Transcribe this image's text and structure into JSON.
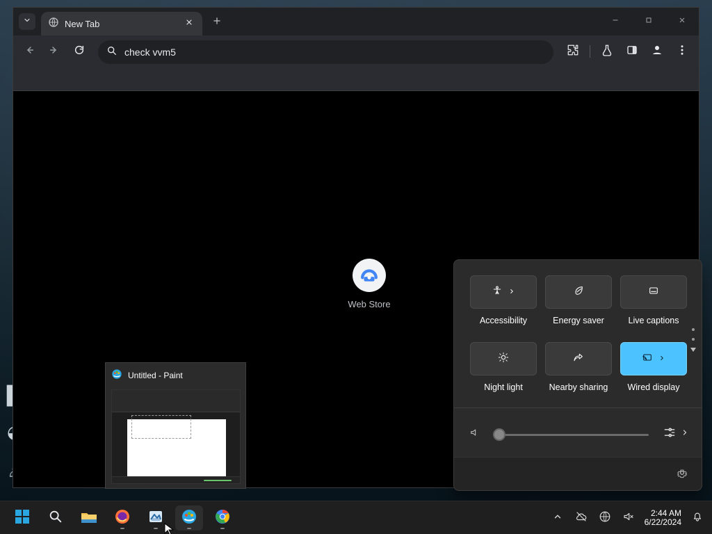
{
  "browser": {
    "tab_title": "New Tab",
    "omnibox_text": "check vvm5"
  },
  "new_tab": {
    "shortcut_label": "Web Store"
  },
  "taskbar_preview": {
    "window_title": "Untitled - Paint"
  },
  "quick_settings": {
    "tiles": [
      {
        "label": "Accessibility",
        "icon": "accessibility-icon",
        "active": false,
        "has_chevron": true
      },
      {
        "label": "Energy saver",
        "icon": "leaf-icon",
        "active": false,
        "has_chevron": false
      },
      {
        "label": "Live captions",
        "icon": "captions-icon",
        "active": false,
        "has_chevron": false
      },
      {
        "label": "Night light",
        "icon": "sun-icon",
        "active": false,
        "has_chevron": false
      },
      {
        "label": "Nearby sharing",
        "icon": "share-icon",
        "active": false,
        "has_chevron": false
      },
      {
        "label": "Wired display",
        "icon": "cast-icon",
        "active": true,
        "has_chevron": true
      }
    ],
    "volume_level": 0.0
  },
  "taskbar": {
    "time": "2:44 AM",
    "date": "6/22/2024"
  },
  "colors": {
    "qs_accent": "#4cc2ff"
  }
}
